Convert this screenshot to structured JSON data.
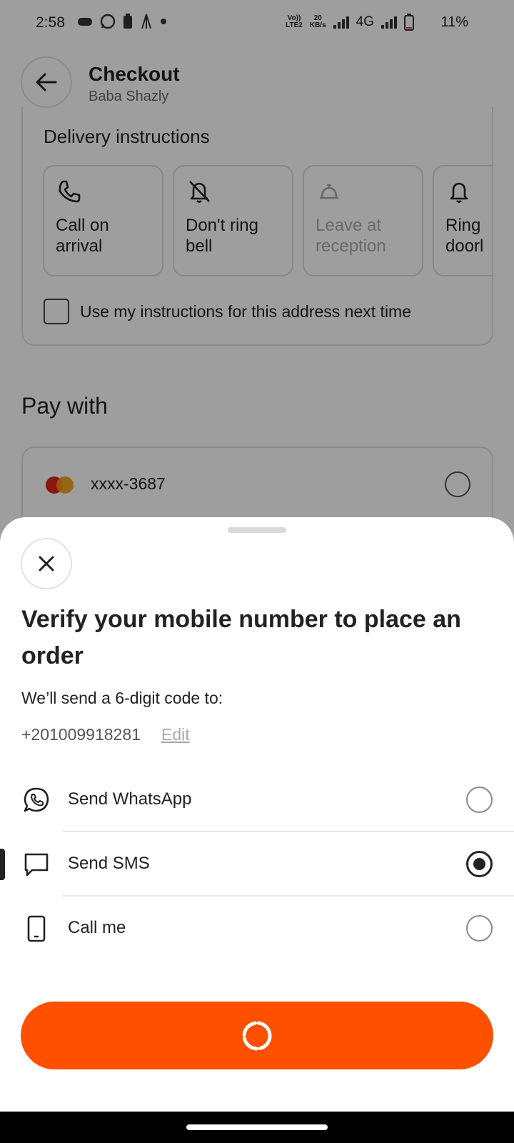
{
  "status_bar": {
    "time": "2:58",
    "net_top": "Vo))",
    "net_bottom": "LTE2",
    "speed_top": "20",
    "speed_bottom": "KB/s",
    "network": "4G",
    "battery": "11%"
  },
  "header": {
    "title": "Checkout",
    "subtitle": "Baba Shazly"
  },
  "delivery_instructions": {
    "title": "Delivery instructions",
    "options": [
      {
        "label_line1": "Call on",
        "label_line2": "arrival",
        "icon": "phone-icon",
        "disabled": false
      },
      {
        "label_line1": "Don't ring",
        "label_line2": "bell",
        "icon": "bell-off-icon",
        "disabled": false
      },
      {
        "label_line1": "Leave at",
        "label_line2": "reception",
        "icon": "service-bell-icon",
        "disabled": true
      },
      {
        "label_line1": "Ring",
        "label_line2": "doorl",
        "icon": "bell-icon",
        "disabled": false
      }
    ],
    "reuse_label": "Use my instructions for this address next time"
  },
  "pay_with": {
    "title": "Pay with",
    "card_number": "xxxx-3687",
    "card_icon": "mastercard-icon"
  },
  "sheet": {
    "title": "Verify your mobile number to place an order",
    "note": "We’ll send a 6-digit code to:",
    "phone": "+201009918281",
    "edit_label": "Edit",
    "methods": [
      {
        "label": "Send WhatsApp",
        "icon": "whatsapp-icon",
        "selected": false
      },
      {
        "label": "Send SMS",
        "icon": "chat-bubble-icon",
        "selected": true
      },
      {
        "label": "Call me",
        "icon": "mobile-phone-icon",
        "selected": false
      }
    ],
    "submit_state": "loading"
  },
  "colors": {
    "accent": "#ff5000",
    "overlay": "#000000",
    "text": "#222222"
  }
}
